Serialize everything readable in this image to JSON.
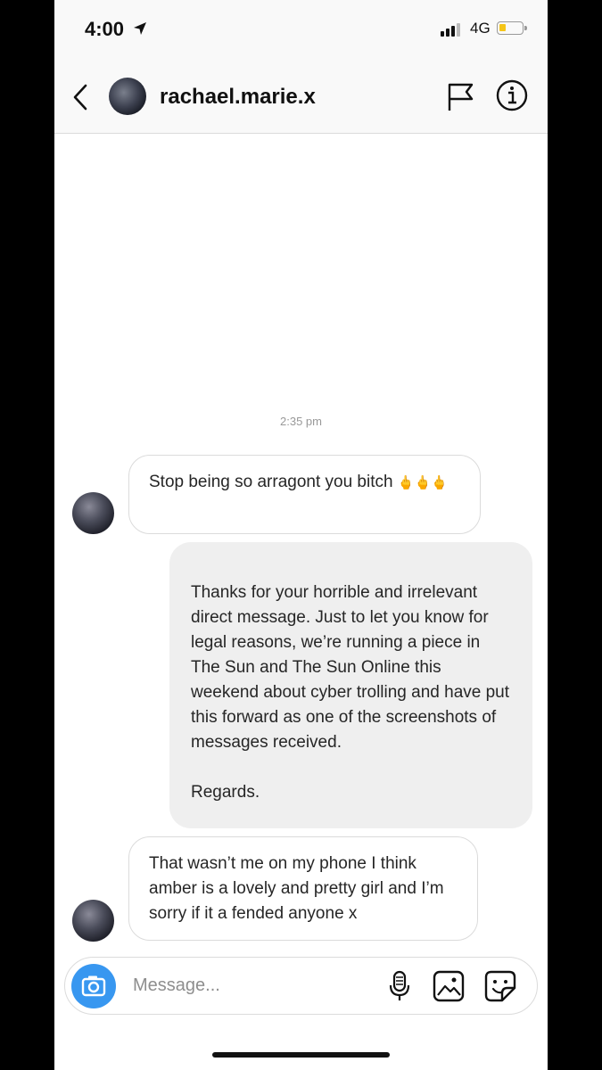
{
  "status_bar": {
    "time": "4:00",
    "network": "4G"
  },
  "header": {
    "username": "rachael.marie.x"
  },
  "thread": {
    "timestamp": "2:35 pm",
    "messages": [
      {
        "direction": "incoming",
        "text": "Stop being so arragont you bitch",
        "emoji": "🖕🖕🖕"
      },
      {
        "direction": "outgoing",
        "text": "Thanks for your horrible and irrelevant direct message. Just to let you know for legal reasons, we’re running a piece in The Sun and The Sun Online this weekend about cyber trolling and have put this forward as one of the screenshots of messages received.\n\nRegards."
      },
      {
        "direction": "incoming",
        "text": "That wasn’t me on my phone I think amber is a lovely and pretty girl and I’m sorry if it a fended anyone x"
      }
    ]
  },
  "composer": {
    "placeholder": "Message..."
  },
  "colors": {
    "accent": "#3897f0",
    "outgoing_bubble": "#efefef",
    "battery": "#f5c518"
  },
  "icons": [
    "location-arrow-icon",
    "signal-icon",
    "battery-icon",
    "back-chevron-icon",
    "flag-icon",
    "info-icon",
    "camera-icon",
    "microphone-icon",
    "gallery-icon",
    "sticker-icon"
  ]
}
